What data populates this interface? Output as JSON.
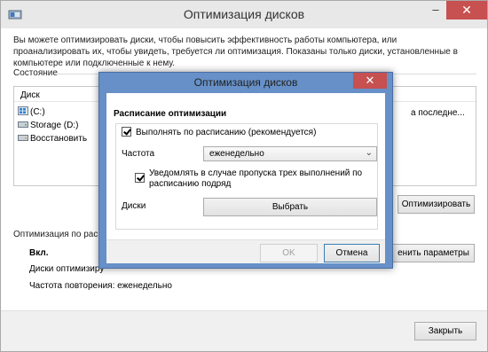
{
  "main_window": {
    "title": "Оптимизация дисков",
    "minimize_label": "–",
    "close_label": "✕",
    "intro_text": "Вы можете оптимизировать диски, чтобы повысить эффективность работы  компьютера, или проанализировать их, чтобы увидеть, требуется ли оптимизация. Показаны только диски, установленные в компьютере или подключенные к нему.",
    "state_label": "Состояние",
    "disk_column_label": "Диск",
    "last_column_partial": "а последне...",
    "drives": [
      {
        "label": "(C:)",
        "icon": "windows-drive-icon"
      },
      {
        "label": "Storage (D:)",
        "icon": "hard-drive-icon"
      },
      {
        "label": "Восстановить",
        "icon": "recovery-drive-icon"
      }
    ],
    "optimize_button": "Оптимизировать",
    "schedule_label": "Оптимизация по распи",
    "schedule_status": "Вкл.",
    "schedule_disks_partial": "Диски оптимизиру",
    "schedule_frequency": "Частота повторения: еженедельно",
    "change_params_button": "енить параметры",
    "close_button": "Закрыть"
  },
  "dialog": {
    "title": "Оптимизация дисков",
    "close_label": "✕",
    "heading": "Расписание оптимизации",
    "run_on_schedule_label": "Выполнять по расписанию (рекомендуется)",
    "run_on_schedule_checked": true,
    "frequency_label": "Частота",
    "frequency_value": "еженедельно",
    "notify_label_line1": "Уведомлять в случае пропуска трех выполнений по",
    "notify_label_line2": "расписанию подряд",
    "notify_checked": true,
    "disks_label": "Диски",
    "choose_button": "Выбрать",
    "ok_button": "OK",
    "cancel_button": "Отмена"
  },
  "colors": {
    "dialog_frame": "#6690c7",
    "close_red": "#c75050",
    "primary_border": "#3c7fb1"
  }
}
